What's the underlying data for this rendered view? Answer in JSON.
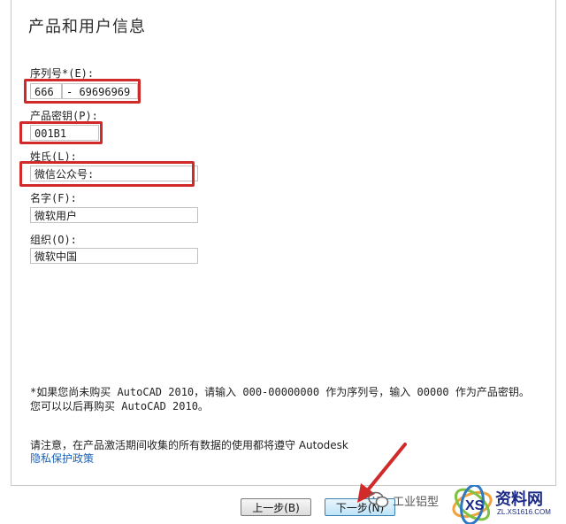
{
  "dialog": {
    "title": "产品和用户信息",
    "serial_label": "序列号*(E):",
    "serial_prefix": "666",
    "serial_suffix": "- 69696969",
    "product_key_label": "产品密钥(P):",
    "product_key_value": "001B1",
    "surname_label": "姓氏(L):",
    "surname_value": "微信公众号:",
    "name_label": "名字(F):",
    "name_value": "微软用户",
    "org_label": "组织(O):",
    "org_value": "微软中国",
    "note_line1": "*如果您尚未购买 AutoCAD 2010，请输入 000-00000000 作为序列号，输入 00000 作为产品密钥。",
    "note_line2": "您可以以后再购买 AutoCAD 2010。",
    "privacy_note": "请注意，在产品激活期间收集的所有数据的使用都将遵守 Autodesk",
    "privacy_link": "隐私保护政策"
  },
  "buttons": {
    "back_label": "上一步(B)",
    "next_label": "下一步(N)"
  },
  "watermark": {
    "wechat_text": "工业铝型",
    "site_name": "资料网",
    "site_url": "ZL.XS1616.COM"
  },
  "colors": {
    "highlight": "#d02a2a",
    "link": "#1a62b8",
    "logo": "#1b2a86"
  }
}
